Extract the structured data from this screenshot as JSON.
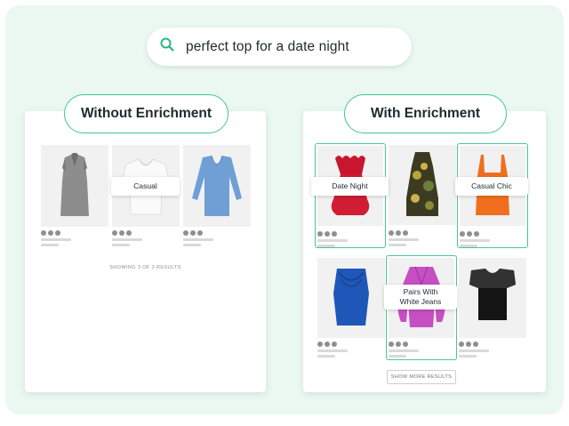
{
  "search": {
    "query": "perfect top for a date night",
    "icon": "search-icon"
  },
  "left_panel": {
    "title": "Without Enrichment",
    "tag": "Casual",
    "footer": "SHOWING 3 OF 3 RESULTS"
  },
  "right_panel": {
    "title": "With Enrichment",
    "tags": {
      "date_night": "Date Night",
      "casual_chic": "Casual Chic",
      "pairs_with": "Pairs With White Jeans"
    },
    "more_button": "SHOW MORE RESULTS"
  },
  "colors": {
    "accent": "#41c493",
    "background": "#eaf8f1"
  }
}
